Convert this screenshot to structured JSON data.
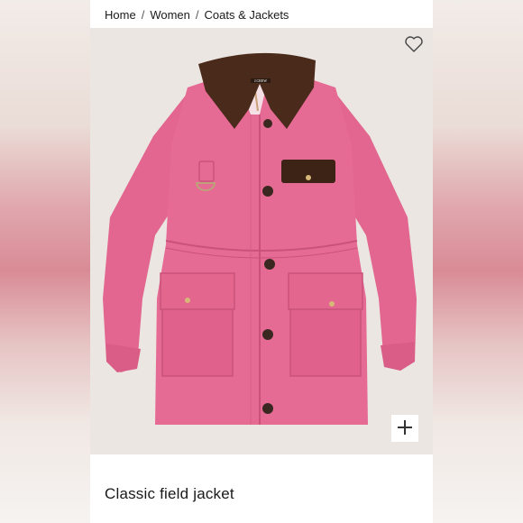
{
  "breadcrumb": {
    "items": [
      "Home",
      "Women",
      "Coats & Jackets"
    ],
    "separator": "/"
  },
  "product": {
    "title": "Classic field jacket",
    "image_label": "J.CREW"
  },
  "icons": {
    "favorite": "heart-icon",
    "zoom": "plus-icon"
  },
  "colors": {
    "jacket": "#e56b95",
    "collar": "#4a2a1a",
    "background": "#ebe6e1"
  }
}
